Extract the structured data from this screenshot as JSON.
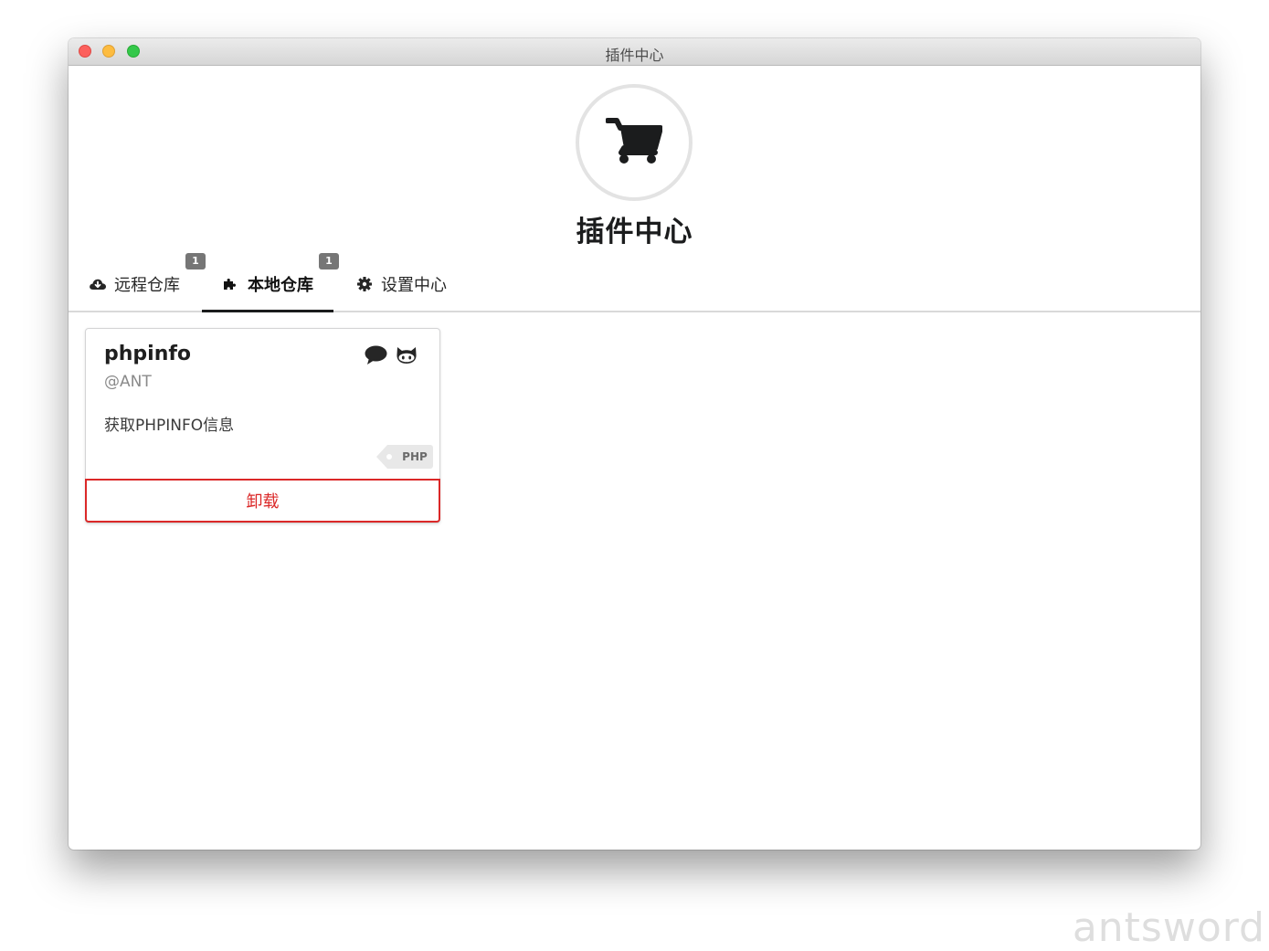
{
  "window": {
    "title": "插件中心"
  },
  "hero": {
    "icon": "shopping-cart-icon",
    "title": "插件中心"
  },
  "tabs": [
    {
      "label": "远程仓库",
      "icon": "cloud-download-icon",
      "badge": "1",
      "active": false
    },
    {
      "label": "本地仓库",
      "icon": "puzzle-piece-icon",
      "badge": "1",
      "active": true
    },
    {
      "label": "设置中心",
      "icon": "gear-icon",
      "active": false
    }
  ],
  "plugin_card": {
    "name": "phpinfo",
    "author": "@ANT",
    "description": "获取PHPINFO信息",
    "tag": "PHP",
    "icons": [
      "comment-icon",
      "github-icon"
    ],
    "action_label": "卸载"
  },
  "watermark": "antsword",
  "colors": {
    "accent_red": "#db2828",
    "badge_grey": "#767676",
    "tab_underline": "#1b1c1d"
  }
}
